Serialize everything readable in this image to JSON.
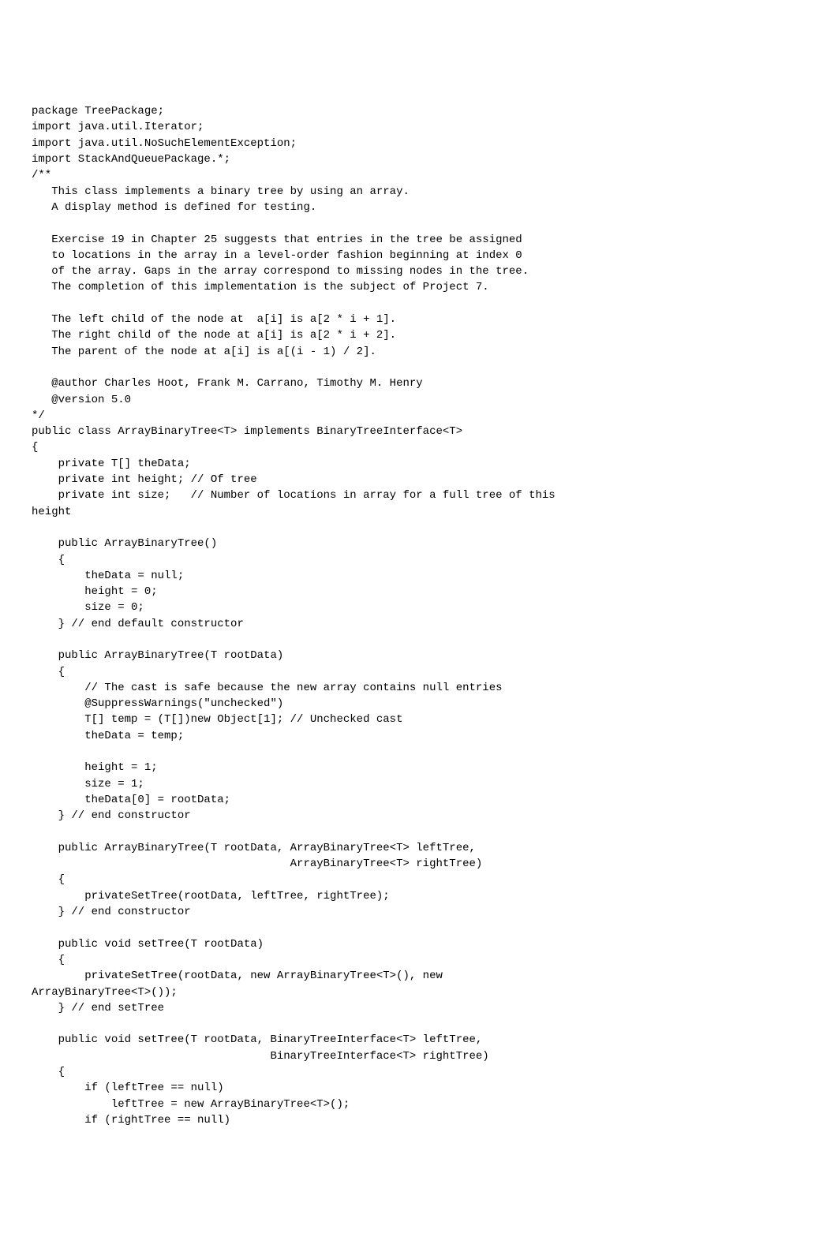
{
  "code": {
    "lines": [
      "package TreePackage;",
      "import java.util.Iterator;",
      "import java.util.NoSuchElementException;",
      "import StackAndQueuePackage.*;",
      "/**",
      "   This class implements a binary tree by using an array.",
      "   A display method is defined for testing.",
      "",
      "   Exercise 19 in Chapter 25 suggests that entries in the tree be assigned",
      "   to locations in the array in a level-order fashion beginning at index 0",
      "   of the array. Gaps in the array correspond to missing nodes in the tree.",
      "   The completion of this implementation is the subject of Project 7.",
      "",
      "   The left child of the node at  a[i] is a[2 * i + 1].",
      "   The right child of the node at a[i] is a[2 * i + 2].",
      "   The parent of the node at a[i] is a[(i - 1) / 2].",
      "",
      "   @author Charles Hoot, Frank M. Carrano, Timothy M. Henry",
      "   @version 5.0",
      "*/",
      "public class ArrayBinaryTree<T> implements BinaryTreeInterface<T>",
      "{ ",
      "    private T[] theData;",
      "    private int height; // Of tree",
      "    private int size;   // Number of locations in array for a full tree of this",
      "height",
      "",
      "    public ArrayBinaryTree()",
      "    {",
      "        theData = null;",
      "        height = 0;",
      "        size = 0;",
      "    } // end default constructor",
      "",
      "    public ArrayBinaryTree(T rootData)",
      "    {",
      "        // The cast is safe because the new array contains null entries",
      "        @SuppressWarnings(\"unchecked\")",
      "        T[] temp = (T[])new Object[1]; // Unchecked cast",
      "        theData = temp;",
      "",
      "        height = 1;",
      "        size = 1;",
      "        theData[0] = rootData;",
      "    } // end constructor",
      "",
      "    public ArrayBinaryTree(T rootData, ArrayBinaryTree<T> leftTree,",
      "                                       ArrayBinaryTree<T> rightTree)",
      "    {",
      "        privateSetTree(rootData, leftTree, rightTree);",
      "    } // end constructor",
      "",
      "    public void setTree(T rootData)",
      "    {",
      "        privateSetTree(rootData, new ArrayBinaryTree<T>(), new",
      "ArrayBinaryTree<T>());",
      "    } // end setTree",
      "",
      "    public void setTree(T rootData, BinaryTreeInterface<T> leftTree,",
      "                                    BinaryTreeInterface<T> rightTree)",
      "    {",
      "        if (leftTree == null)",
      "            leftTree = new ArrayBinaryTree<T>();",
      "        if (rightTree == null)"
    ]
  }
}
